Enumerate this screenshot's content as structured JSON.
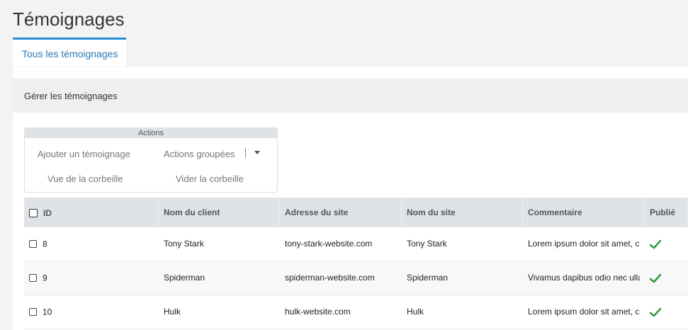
{
  "page": {
    "title": "Témoignages"
  },
  "tabs": [
    {
      "label": "Tous les témoignages",
      "active": true
    }
  ],
  "panel": {
    "header": "Gérer les témoignages"
  },
  "actions": {
    "title": "Actions",
    "add": "Ajouter un témoignage",
    "bulk": "Actions groupées",
    "trash_view": "Vue de la corbeille",
    "trash_empty": "Vider la corbeille"
  },
  "table": {
    "columns": [
      "ID",
      "Nom du client",
      "Adresse du site",
      "Nom du site",
      "Commentaire",
      "Publié"
    ],
    "rows": [
      {
        "id": "8",
        "client": "Tony Stark",
        "site_url": "tony-stark-website.com",
        "site_name": "Tony Stark",
        "comment": "Lorem ipsum dolor sit amet, co",
        "published": true
      },
      {
        "id": "9",
        "client": "Spiderman",
        "site_url": "spiderman-website.com",
        "site_name": "Spiderman",
        "comment": "Vivamus dapibus odio nec ullan",
        "published": true
      },
      {
        "id": "10",
        "client": "Hulk",
        "site_url": "hulk-website.com",
        "site_name": "Hulk",
        "comment": "Lorem ipsum dolor sit amet, co",
        "published": true
      }
    ]
  },
  "colors": {
    "accent": "#2a8fd6",
    "check": "#3c9a3c"
  },
  "icons": {
    "published": "checkmark-icon",
    "bulk_dropdown": "caret-down-icon"
  }
}
